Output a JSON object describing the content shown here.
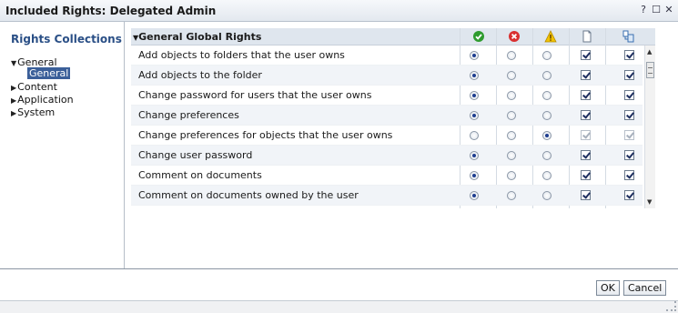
{
  "window": {
    "title": "Included Rights: Delegated Admin",
    "help_label": "?",
    "maximize_label": "☐",
    "close_label": "✕"
  },
  "sidebar": {
    "title": "Rights Collections",
    "items": [
      {
        "label": "General",
        "expanded": true
      },
      {
        "label": "General",
        "selected": true
      },
      {
        "label": "Content",
        "expanded": false
      },
      {
        "label": "Application",
        "expanded": false
      },
      {
        "label": "System",
        "expanded": false
      }
    ]
  },
  "rights_table": {
    "header_title": "General Global Rights",
    "column_icons": [
      "granted-icon",
      "denied-icon",
      "not-specified-icon",
      "apply-to-object-icon",
      "apply-to-subobjects-icon"
    ],
    "colors": {
      "granted": "#2e9b2e",
      "denied": "#d93030",
      "not_specified": "#e8b400",
      "selection": "#3b5f99"
    },
    "rows": [
      {
        "label": "Add objects to folders that the user owns",
        "state": "granted",
        "object": true,
        "subobjects": true,
        "disabled": false
      },
      {
        "label": "Add objects to the folder",
        "state": "granted",
        "object": true,
        "subobjects": true,
        "disabled": false
      },
      {
        "label": "Change password for users that the user owns",
        "state": "granted",
        "object": true,
        "subobjects": true,
        "disabled": false
      },
      {
        "label": "Change preferences",
        "state": "granted",
        "object": true,
        "subobjects": true,
        "disabled": false
      },
      {
        "label": "Change preferences for objects that the user owns",
        "state": "not_specified",
        "object": true,
        "subobjects": true,
        "disabled": true
      },
      {
        "label": "Change user password",
        "state": "granted",
        "object": true,
        "subobjects": true,
        "disabled": false
      },
      {
        "label": "Comment on documents",
        "state": "granted",
        "object": true,
        "subobjects": true,
        "disabled": false
      },
      {
        "label": "Comment on documents owned by the user",
        "state": "granted",
        "object": true,
        "subobjects": true,
        "disabled": false
      }
    ]
  },
  "footer": {
    "ok_label": "OK",
    "cancel_label": "Cancel"
  }
}
